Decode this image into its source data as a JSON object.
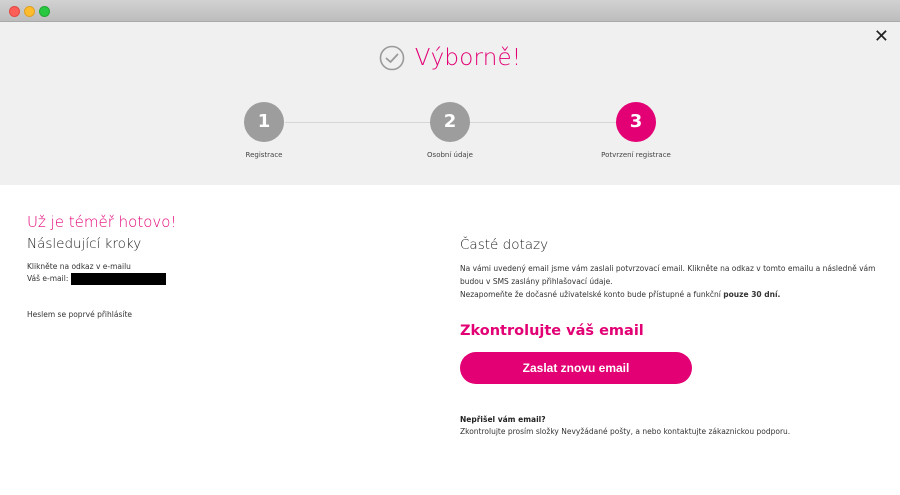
{
  "header": {
    "title": "Výborně!",
    "icon": "check-circle-icon",
    "close_icon": "close-icon",
    "close_symbol": "✕"
  },
  "steps": [
    {
      "number": "1",
      "label": "Registrace",
      "active": false
    },
    {
      "number": "2",
      "label": "Osobní údaje",
      "active": false
    },
    {
      "number": "3",
      "label": "Potvrzení registrace",
      "active": true
    }
  ],
  "left": {
    "almost_done": "Už je téměř hotovo!",
    "next_steps": "Následující kroky",
    "click_link": "Klikněte na odkaz v e-mailu",
    "your_email_label": "Váš e-mail:",
    "login_hint": "Heslem se poprvé přihlásíte"
  },
  "right": {
    "faq_title": "Časté dotazy",
    "faq_text": "Na vámi uvedený email jsme vám zaslali potvrzovací email. Klikněte na odkaz v tomto emailu a následně vám budou v SMS zaslány přihlašovací údaje.",
    "faq_note_prefix": "Nezapomeňte že dočasné uživatelské konto bude přístupné a funkční ",
    "faq_note_bold": "pouze 30 dní.",
    "check_email": "Zkontrolujte váš email",
    "resend_button": "Zaslat znovu email",
    "no_email_title": "Nepřišel vám email?",
    "no_email_text": "Zkontrolujte prosím složky Nevyžádané pošty, a nebo kontaktujte zákaznickou podporu."
  },
  "colors": {
    "accent": "#e20074",
    "step_inactive": "#9d9d9d",
    "top_band": "#f0f0f0"
  }
}
